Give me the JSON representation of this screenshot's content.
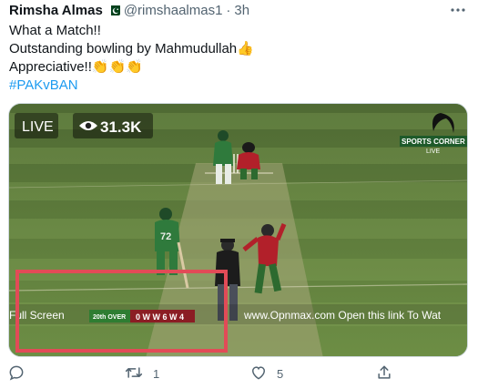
{
  "author": {
    "name": "Rimsha Almas",
    "handle": "@rimshaalmas1",
    "separator": "·",
    "time": "3h",
    "flag_icon": "pakistan-flag-icon"
  },
  "tweet": {
    "lines": [
      "What a Match!!",
      "Outstanding bowling by Mahmudullah👍",
      "Appreciative!!👏👏👏"
    ],
    "hashtag": "#PAKvBAN"
  },
  "video": {
    "live_label": "LIVE",
    "view_count": "31.3K",
    "channel_logo_text": "SPORTS CORNER",
    "channel_live": "LIVE",
    "jersey_number": "72",
    "ticker_left": "Full Screen",
    "over_label": "20th OVER",
    "over_balls": "0 W W 6 W 4",
    "ticker_right": "www.Opnmax.com Open this link To Wat"
  },
  "actions": {
    "reply_count": "",
    "retweet_count": "1",
    "like_count": "5"
  },
  "colors": {
    "hashtag": "#1d9bf0",
    "highlight_box": "#e24b57",
    "pitch_green": "#6e9146",
    "over_badge": "#2e7d32",
    "over_balls_bg": "#8b1d24"
  }
}
